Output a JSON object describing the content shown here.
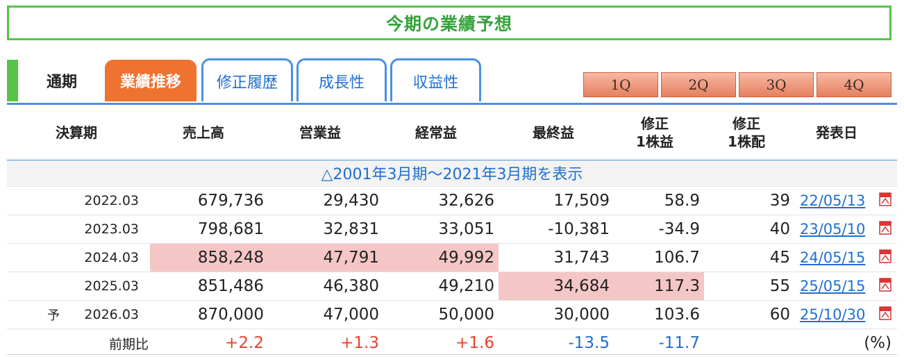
{
  "title": "今期の業績予想",
  "tabs": {
    "fiscal": "通期",
    "active": "業績推移",
    "links": [
      "修正履歴",
      "成長性",
      "収益性"
    ],
    "quarters": [
      "1Q",
      "2Q",
      "3Q",
      "4Q"
    ]
  },
  "headers": {
    "period": "決算期",
    "sales": "売上高",
    "op": "営業益",
    "ord": "経常益",
    "net": "最終益",
    "eps_l1": "修正",
    "eps_l2": "1株益",
    "div_l1": "修正",
    "div_l2": "1株配",
    "date": "発表日"
  },
  "expand_link": "△2001年3月期～2021年3月期を表示",
  "rows": [
    {
      "period": "2022.03",
      "sales": "679,736",
      "op": "29,430",
      "ord": "32,626",
      "net": "17,509",
      "eps": "58.9",
      "div": "39",
      "date": "22/05/13"
    },
    {
      "period": "2023.03",
      "sales": "798,681",
      "op": "32,831",
      "ord": "33,051",
      "net": "-10,381",
      "eps": "-34.9",
      "div": "40",
      "date": "23/05/10"
    },
    {
      "period": "2024.03",
      "sales": "858,248",
      "op": "47,791",
      "ord": "49,992",
      "net": "31,743",
      "eps": "106.7",
      "div": "45",
      "date": "24/05/15"
    },
    {
      "period": "2025.03",
      "sales": "851,486",
      "op": "46,380",
      "ord": "49,210",
      "net": "34,684",
      "eps": "117.3",
      "div": "55",
      "date": "25/05/15"
    },
    {
      "prefix": "予",
      "period": "2026.03",
      "sales": "870,000",
      "op": "47,000",
      "ord": "50,000",
      "net": "30,000",
      "eps": "103.6",
      "div": "60",
      "date": "25/10/30"
    }
  ],
  "yoy": {
    "label": "前期比",
    "sales": "+2.2",
    "op": "+1.3",
    "ord": "+1.6",
    "net": "-13.5",
    "eps": "-11.7",
    "unit": "(%)"
  },
  "colors": {
    "green": "#55c548",
    "orange_tab": "#ee7230",
    "blue": "#1f6fd1",
    "highlight": "#f5c6c6",
    "positive": "#e8412a"
  }
}
